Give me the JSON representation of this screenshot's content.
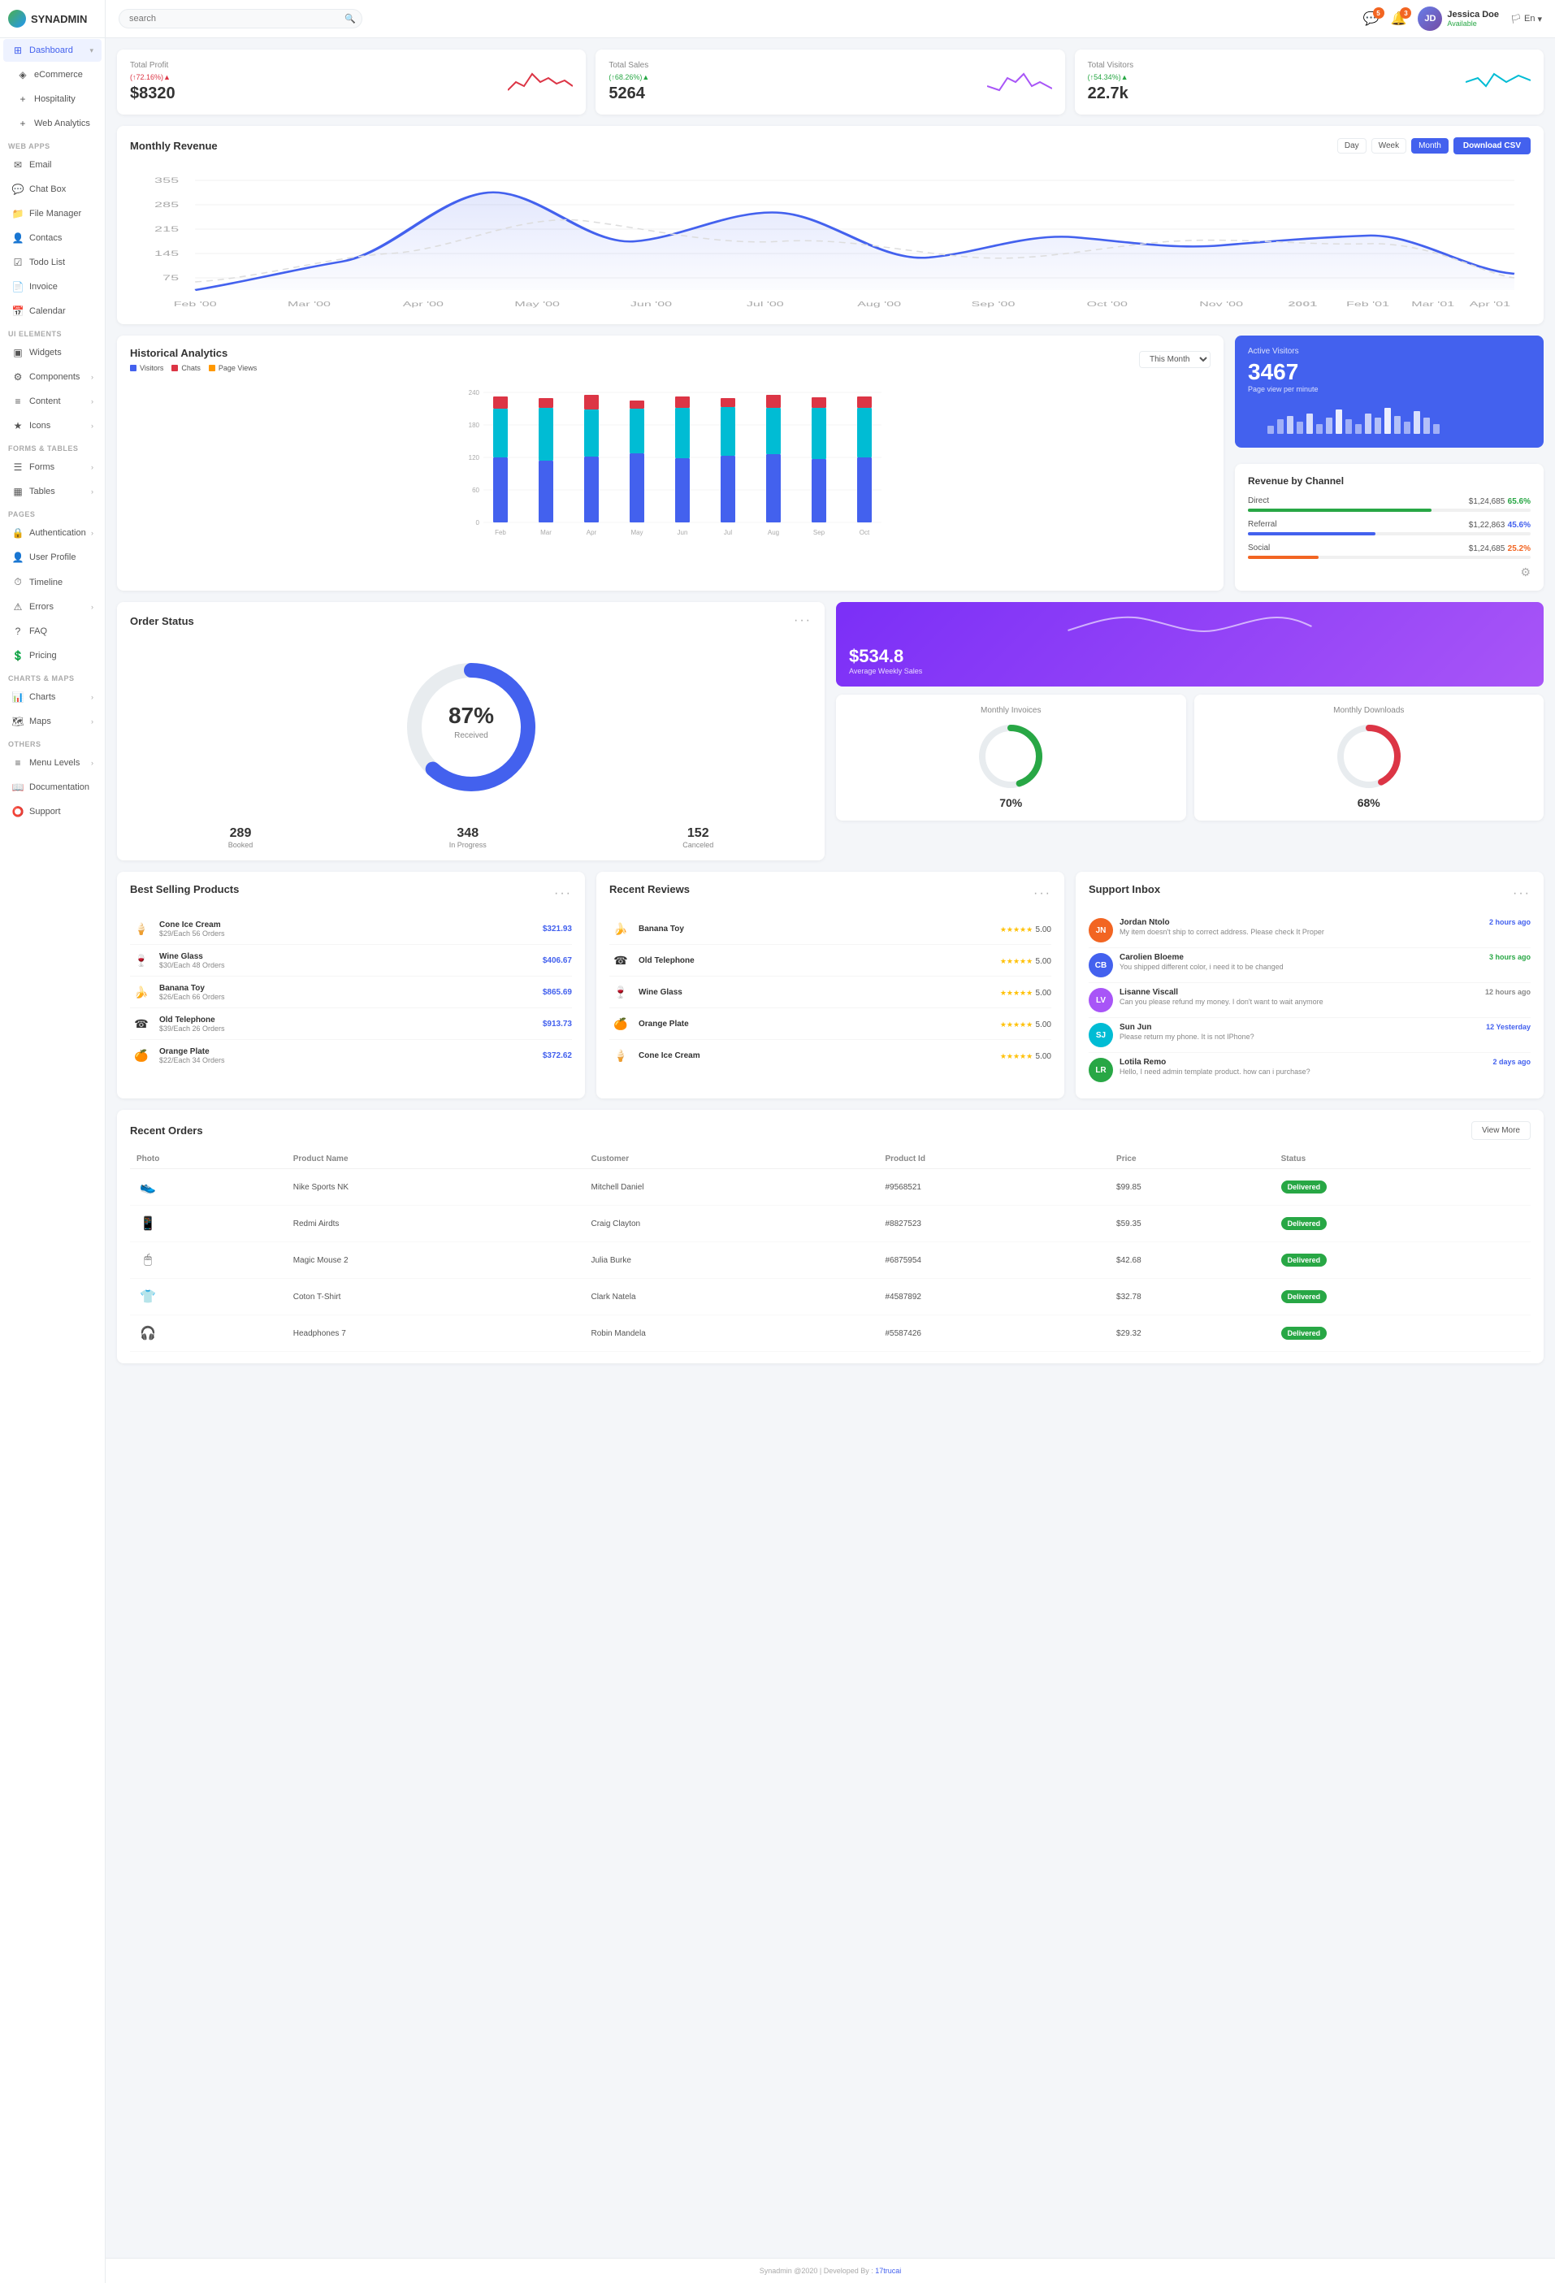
{
  "app": {
    "name": "SYNADMIN",
    "logo_color": "#4361ee"
  },
  "topbar": {
    "search_placeholder": "search",
    "notification_count_messages": "5",
    "notification_count_alerts": "3",
    "user_name": "Jessica Doe",
    "user_status": "Available",
    "user_initials": "JD",
    "language": "En"
  },
  "sidebar": {
    "sections": [
      {
        "label": "",
        "items": [
          {
            "id": "dashboard",
            "label": "Dashboard",
            "icon": "⊞",
            "active": true,
            "has_sub": true
          },
          {
            "id": "ecommerce",
            "label": "eCommerce",
            "icon": "◈",
            "active": false,
            "has_sub": true
          },
          {
            "id": "hospitality",
            "label": "Hospitality",
            "icon": "+",
            "active": false
          },
          {
            "id": "web-analytics",
            "label": "Web Analytics",
            "icon": "+",
            "active": false
          }
        ]
      },
      {
        "label": "WEB APPS",
        "items": [
          {
            "id": "email",
            "label": "Email",
            "icon": "✉",
            "active": false
          },
          {
            "id": "chat-box",
            "label": "Chat Box",
            "icon": "💬",
            "active": false
          },
          {
            "id": "file-manager",
            "label": "File Manager",
            "icon": "📁",
            "active": false
          },
          {
            "id": "contacts",
            "label": "Contacs",
            "icon": "👤",
            "active": false
          },
          {
            "id": "todo-list",
            "label": "Todo List",
            "icon": "☑",
            "active": false
          },
          {
            "id": "invoice",
            "label": "Invoice",
            "icon": "📄",
            "active": false
          },
          {
            "id": "calendar",
            "label": "Calendar",
            "icon": "📅",
            "active": false
          }
        ]
      },
      {
        "label": "UI ELEMENTS",
        "items": [
          {
            "id": "widgets",
            "label": "Widgets",
            "icon": "▣",
            "active": false
          },
          {
            "id": "components",
            "label": "Components",
            "icon": "⚙",
            "active": false,
            "has_sub": true
          },
          {
            "id": "content",
            "label": "Content",
            "icon": "≡",
            "active": false,
            "has_sub": true
          },
          {
            "id": "icons",
            "label": "Icons",
            "icon": "★",
            "active": false,
            "has_sub": true
          }
        ]
      },
      {
        "label": "FORMS & TABLES",
        "items": [
          {
            "id": "forms",
            "label": "Forms",
            "icon": "☰",
            "active": false,
            "has_sub": true
          },
          {
            "id": "tables",
            "label": "Tables",
            "icon": "▦",
            "active": false,
            "has_sub": true
          }
        ]
      },
      {
        "label": "PAGES",
        "items": [
          {
            "id": "authentication",
            "label": "Authentication",
            "icon": "🔒",
            "active": false,
            "has_sub": true
          },
          {
            "id": "user-profile",
            "label": "User Profile",
            "icon": "👤",
            "active": false
          },
          {
            "id": "timeline",
            "label": "Timeline",
            "icon": "⏱",
            "active": false
          },
          {
            "id": "errors",
            "label": "Errors",
            "icon": "⚠",
            "active": false,
            "has_sub": true
          },
          {
            "id": "faq",
            "label": "FAQ",
            "icon": "?",
            "active": false
          },
          {
            "id": "pricing",
            "label": "Pricing",
            "icon": "💲",
            "active": false
          }
        ]
      },
      {
        "label": "CHARTS & MAPS",
        "items": [
          {
            "id": "charts",
            "label": "Charts",
            "icon": "📊",
            "active": false,
            "has_sub": true
          },
          {
            "id": "maps",
            "label": "Maps",
            "icon": "🗺",
            "active": false,
            "has_sub": true
          }
        ]
      },
      {
        "label": "OTHERS",
        "items": [
          {
            "id": "menu-levels",
            "label": "Menu Levels",
            "icon": "≡",
            "active": false,
            "has_sub": true
          },
          {
            "id": "documentation",
            "label": "Documentation",
            "icon": "📖",
            "active": false
          },
          {
            "id": "support",
            "label": "Support",
            "icon": "⭕",
            "active": false
          }
        ]
      }
    ]
  },
  "stats": [
    {
      "id": "total-profit",
      "label": "Total Profit",
      "value": "$8320",
      "change": "(↑72.16%)▲",
      "change_type": "up",
      "color": "#dc3545"
    },
    {
      "id": "total-sales",
      "label": "Total Sales",
      "value": "5264",
      "change": "(↑68.26%)▲",
      "change_type": "up",
      "color": "#a855f7"
    },
    {
      "id": "total-visitors",
      "label": "Total Visitors",
      "value": "22.7k",
      "change": "(↑54.34%)▲",
      "change_type": "up",
      "color": "#00bcd4"
    }
  ],
  "monthly_revenue": {
    "title": "Monthly Revenue",
    "controls": [
      "Day",
      "Week",
      "Month"
    ],
    "active_control": "Month",
    "download_btn": "Download CSV"
  },
  "historical_analytics": {
    "title": "Historical Analytics",
    "select_label": "This Month",
    "legend": [
      {
        "label": "Visitors",
        "color": "#4361ee"
      },
      {
        "label": "Chats",
        "color": "#dc3545"
      },
      {
        "label": "Page Views",
        "color": "#00bcd4"
      }
    ],
    "months": [
      "Feb",
      "Mar",
      "Apr",
      "May",
      "Jun",
      "Jul",
      "Aug",
      "Sep",
      "Oct"
    ]
  },
  "active_visitors": {
    "count": "3467",
    "label": "Page view per minute"
  },
  "revenue_by_channel": {
    "title": "Revenue by Channel",
    "channels": [
      {
        "name": "Direct",
        "amount": "$1,24,685",
        "pct": "65.6%",
        "pct_class": "green",
        "bar_width": "65",
        "bar_color": "#28a745"
      },
      {
        "name": "Referral",
        "amount": "$1,22,863",
        "pct": "45.6%",
        "pct_class": "blue",
        "bar_width": "45",
        "bar_color": "#4361ee"
      },
      {
        "name": "Social",
        "amount": "$1,24,685",
        "pct": "25.2%",
        "pct_class": "orange",
        "bar_width": "25",
        "bar_color": "#f26522"
      }
    ]
  },
  "order_status": {
    "title": "Order Status",
    "donut_pct": 87,
    "donut_label": "Received",
    "stats": [
      {
        "value": "289",
        "label": "Booked"
      },
      {
        "value": "348",
        "label": "In Progress"
      },
      {
        "value": "152",
        "label": "Canceled"
      }
    ]
  },
  "weekly_sales": {
    "amount": "$534.8",
    "label": "Average Weekly Sales"
  },
  "monthly_invoices": {
    "label": "Monthly Invoices",
    "pct": 70,
    "pct_text": "70%",
    "color": "#28a745"
  },
  "monthly_downloads": {
    "label": "Monthly Downloads",
    "pct": 68,
    "pct_text": "68%",
    "color": "#dc3545"
  },
  "best_selling": {
    "title": "Best Selling Products",
    "products": [
      {
        "name": "Cone Ice Cream",
        "sub": "$29/Each 56 Orders",
        "price": "$321.93",
        "icon": "🍦"
      },
      {
        "name": "Wine Glass",
        "sub": "$30/Each 48 Orders",
        "price": "$406.67",
        "icon": "🍷"
      },
      {
        "name": "Banana Toy",
        "sub": "$26/Each 66 Orders",
        "price": "$865.69",
        "icon": "🍌"
      },
      {
        "name": "Old Telephone",
        "sub": "$39/Each 26 Orders",
        "price": "$913.73",
        "icon": "☎"
      },
      {
        "name": "Orange Plate",
        "sub": "$22/Each 34 Orders",
        "price": "$372.62",
        "icon": "🍊"
      }
    ]
  },
  "recent_reviews": {
    "title": "Recent Reviews",
    "reviews": [
      {
        "name": "Banana Toy",
        "rating": "5.00",
        "icon": "🍌"
      },
      {
        "name": "Old Telephone",
        "rating": "5.00",
        "icon": "☎"
      },
      {
        "name": "Wine Glass",
        "rating": "5.00",
        "icon": "🍷"
      },
      {
        "name": "Orange Plate",
        "rating": "5.00",
        "icon": "🍊"
      },
      {
        "name": "Cone Ice Cream",
        "rating": "5.00",
        "icon": "🍦"
      }
    ]
  },
  "support_inbox": {
    "title": "Support Inbox",
    "messages": [
      {
        "name": "Jordan Ntolo",
        "time": "2 hours ago",
        "time_color": "#4361ee",
        "msg": "My item doesn't ship to correct address. Please check It Proper",
        "initials": "JN",
        "bg": "#f26522"
      },
      {
        "name": "Carolien Bloeme",
        "time": "3 hours ago",
        "time_color": "#28a745",
        "msg": "You shipped different color, i need it to be changed",
        "initials": "CB",
        "bg": "#4361ee"
      },
      {
        "name": "Lisanne Viscall",
        "time": "12 hours ago",
        "time_color": "#888",
        "msg": "Can you please refund my money. I don't want to wait anymore",
        "initials": "LV",
        "bg": "#a855f7"
      },
      {
        "name": "Sun Jun",
        "time": "12 Yesterday",
        "time_color": "#4361ee",
        "msg": "Please return my phone. It is not IPhone?",
        "initials": "SJ",
        "bg": "#00bcd4"
      },
      {
        "name": "Lotila Remo",
        "time": "2 days ago",
        "time_color": "#4361ee",
        "msg": "Hello, I need admin template product. how can i purchase?",
        "initials": "LR",
        "bg": "#28a745"
      }
    ]
  },
  "recent_orders": {
    "title": "Recent Orders",
    "view_more": "View More",
    "columns": [
      "Photo",
      "Product Name",
      "Customer",
      "Product Id",
      "Price",
      "Status"
    ],
    "rows": [
      {
        "icon": "👟",
        "name": "Nike Sports NK",
        "customer": "Mitchell Daniel",
        "id": "#9568521",
        "price": "$99.85",
        "status": "Delivered"
      },
      {
        "icon": "📱",
        "name": "Redmi Airdts",
        "customer": "Craig Clayton",
        "id": "#8827523",
        "price": "$59.35",
        "status": "Delivered"
      },
      {
        "icon": "🖱",
        "name": "Magic Mouse 2",
        "customer": "Julia Burke",
        "id": "#6875954",
        "price": "$42.68",
        "status": "Delivered"
      },
      {
        "icon": "👕",
        "name": "Coton T-Shirt",
        "customer": "Clark Natela",
        "id": "#4587892",
        "price": "$32.78",
        "status": "Delivered"
      },
      {
        "icon": "🎧",
        "name": "Headphones 7",
        "customer": "Robin Mandela",
        "id": "#5587426",
        "price": "$29.32",
        "status": "Delivered"
      }
    ]
  },
  "footer": {
    "text": "Synadmin @2020 | Developed By :",
    "link_text": "17trucai",
    "link_url": "#"
  }
}
